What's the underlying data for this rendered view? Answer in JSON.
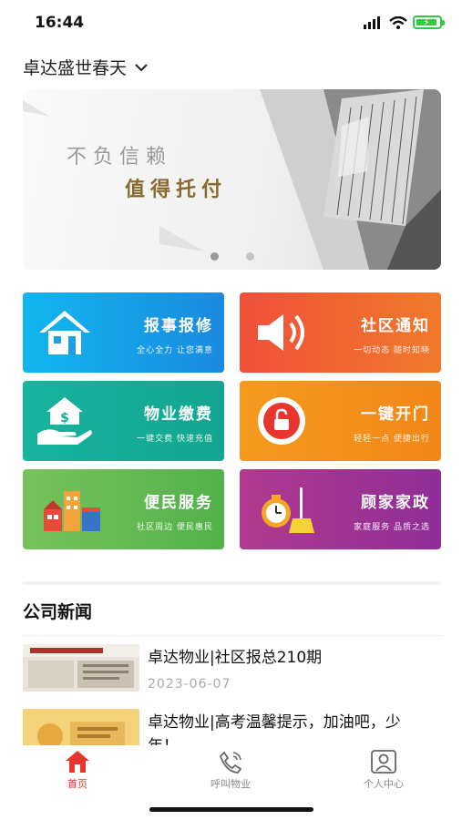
{
  "status_bar": {
    "time": "16:44"
  },
  "header": {
    "community_name": "卓达盛世春天"
  },
  "banner": {
    "line1": "不负信赖",
    "line2": "值得托付",
    "page_count": 2,
    "active_page": 1
  },
  "services": [
    {
      "title": "报事报修",
      "subtitle": "全心全力 让您满意",
      "icon": "house-icon",
      "color_from": "#12b6ef",
      "color_to": "#1a8ae0"
    },
    {
      "title": "社区通知",
      "subtitle": "一切动态 随时知晓",
      "icon": "speaker-icon",
      "color_from": "#f0503a",
      "color_to": "#f07a2a"
    },
    {
      "title": "物业缴费",
      "subtitle": "一键交费 快速充值",
      "icon": "payment-icon",
      "color_from": "#17b49e",
      "color_to": "#13a58f"
    },
    {
      "title": "一键开门",
      "subtitle": "轻轻一点 便捷出行",
      "icon": "unlock-icon",
      "color_from": "#f59a1e",
      "color_to": "#f28718"
    },
    {
      "title": "便民服务",
      "subtitle": "社区周边 便民惠民",
      "icon": "shops-icon",
      "color_from": "#78c25c",
      "color_to": "#52b14a"
    },
    {
      "title": "顾家家政",
      "subtitle": "家庭服务 品质之选",
      "icon": "housekeeping-icon",
      "color_from": "#b03a8e",
      "color_to": "#8f2e98"
    }
  ],
  "news_section": {
    "title": "公司新闻",
    "items": [
      {
        "title": "卓达物业|社区报总210期",
        "date": "2023-06-07"
      },
      {
        "title": "卓达物业|高考温馨提示，加油吧，少年！",
        "date": ""
      }
    ]
  },
  "tabbar": [
    {
      "label": "首页",
      "icon": "home-icon",
      "active": true
    },
    {
      "label": "呼叫物业",
      "icon": "phone-icon",
      "active": false
    },
    {
      "label": "个人中心",
      "icon": "profile-icon",
      "active": false
    }
  ]
}
